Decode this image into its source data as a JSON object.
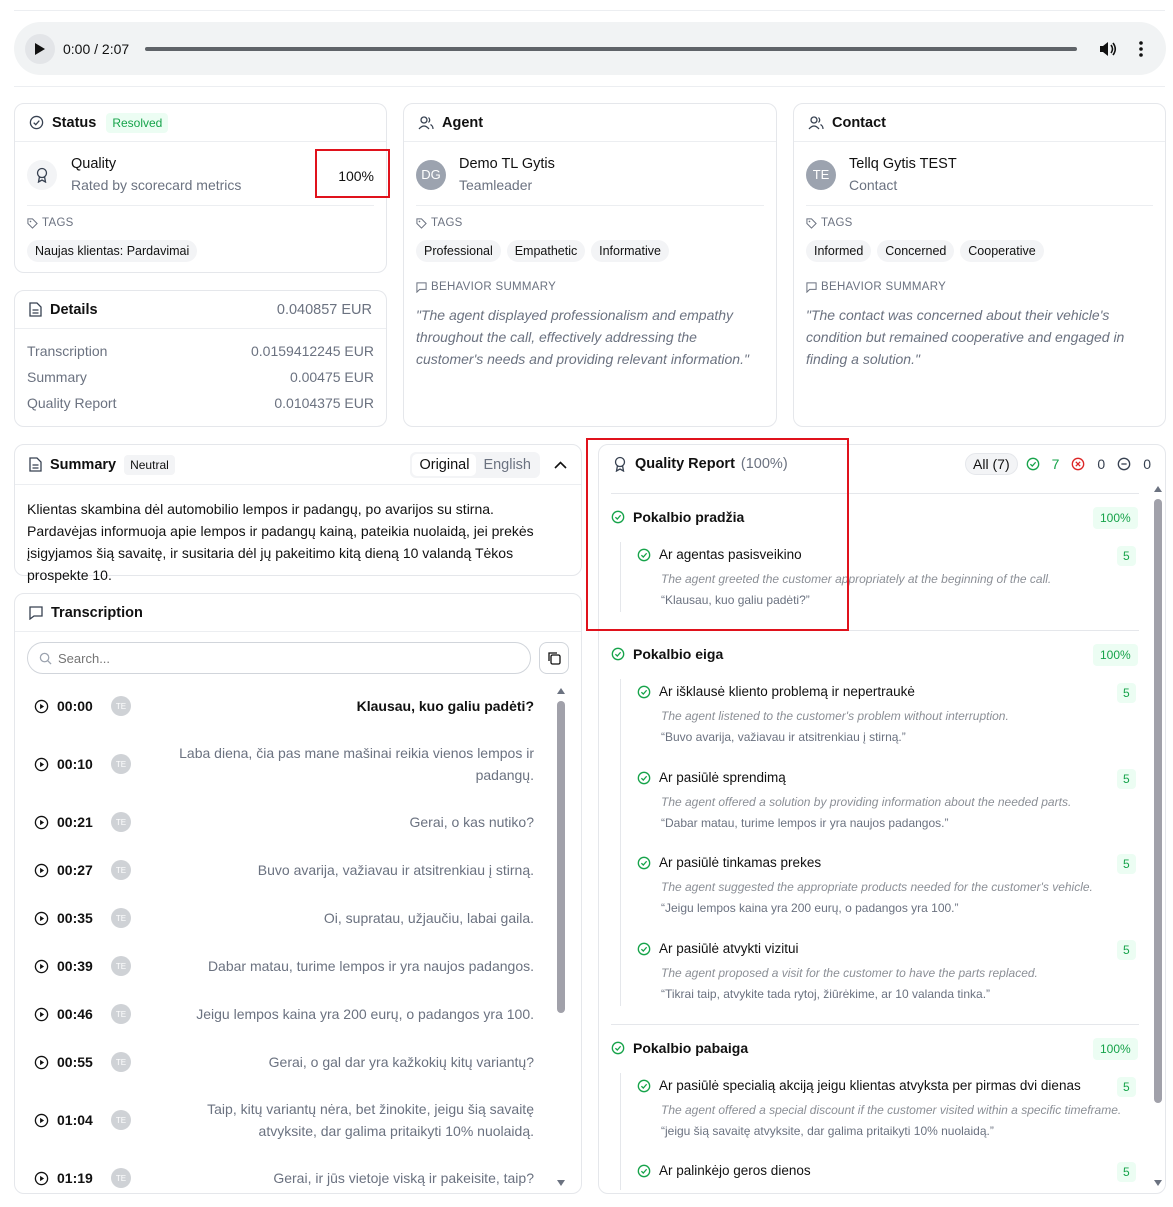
{
  "player": {
    "time": "0:00 / 2:07"
  },
  "status": {
    "title": "Status",
    "badge": "Resolved",
    "quality_label": "Quality",
    "quality_sub": "Rated by scorecard metrics",
    "quality_value": "100%",
    "tags_label": "TAGS",
    "tags": [
      "Naujas klientas: Pardavimai"
    ]
  },
  "details": {
    "title": "Details",
    "total": "0.040857 EUR",
    "rows": [
      {
        "label": "Transcription",
        "value": "0.0159412245 EUR"
      },
      {
        "label": "Summary",
        "value": "0.00475 EUR"
      },
      {
        "label": "Quality Report",
        "value": "0.0104375 EUR"
      }
    ]
  },
  "agent": {
    "title": "Agent",
    "initials": "DG",
    "name": "Demo TL Gytis",
    "role": "Teamleader",
    "tags_label": "TAGS",
    "tags": [
      "Professional",
      "Empathetic",
      "Informative"
    ],
    "behavior_label": "BEHAVIOR SUMMARY",
    "behavior": "\"The agent displayed professionalism and empathy throughout the call, effectively addressing the customer's needs and providing relevant information.\""
  },
  "contact": {
    "title": "Contact",
    "initials": "TE",
    "name": "Tellq Gytis TEST",
    "role": "Contact",
    "tags_label": "TAGS",
    "tags": [
      "Informed",
      "Concerned",
      "Cooperative"
    ],
    "behavior_label": "BEHAVIOR SUMMARY",
    "behavior": "\"The contact was concerned about their vehicle's condition but remained cooperative and engaged in finding a solution.\""
  },
  "summary": {
    "title": "Summary",
    "badge": "Neutral",
    "tab_original": "Original",
    "tab_english": "English",
    "text": "Klientas skambina dėl automobilio lempos ir padangų, po avarijos su stirna. Pardavėjas informuoja apie lempos ir padangų kainą, pateikia nuolaidą, jei prekės įsigyjamos šią savaitę, ir susitaria dėl jų pakeitimo kitą dieną 10 valandą Tėkos prospekte 10."
  },
  "transcription": {
    "title": "Transcription",
    "search_placeholder": "Search...",
    "speaker": "TE",
    "rows": [
      {
        "time": "00:00",
        "text": "Klausau, kuo galiu padėti?",
        "bold": true
      },
      {
        "time": "00:10",
        "text": "Laba diena, čia pas mane mašinai reikia vienos lempos ir padangų."
      },
      {
        "time": "00:21",
        "text": "Gerai, o kas nutiko?"
      },
      {
        "time": "00:27",
        "text": "Buvo avarija, važiavau ir atsitrenkiau į stirną."
      },
      {
        "time": "00:35",
        "text": "Oi, supratau, užjaučiu, labai gaila."
      },
      {
        "time": "00:39",
        "text": "Dabar matau, turime lempos ir yra naujos padangos."
      },
      {
        "time": "00:46",
        "text": "Jeigu lempos kaina yra 200 eurų, o padangos yra 100."
      },
      {
        "time": "00:55",
        "text": "Gerai, o gal dar yra kažkokių kitų variantų?"
      },
      {
        "time": "01:04",
        "text": "Taip, kitų variantų nėra, bet žinokite, jeigu šią savaitę atvyksite, dar galima pritaikyti 10% nuolaidą."
      },
      {
        "time": "01:19",
        "text": "Gerai, ir jūs vietoje viską ir pakeisite, taip?"
      }
    ]
  },
  "quality": {
    "title": "Quality Report",
    "pct": "(100%)",
    "filter_all": "All (7)",
    "pass_count": "7",
    "fail_count": "0",
    "na_count": "0",
    "sections": [
      {
        "name": "Pokalbio pradžia",
        "pct": "100%",
        "items": [
          {
            "name": "Ar agentas pasisveikino",
            "score": "5",
            "desc": "The agent greeted the customer appropriately at the beginning of the call.",
            "quote": "“Klausau, kuo galiu padėti?”"
          }
        ]
      },
      {
        "name": "Pokalbio eiga",
        "pct": "100%",
        "items": [
          {
            "name": "Ar išklausė kliento problemą ir nepertraukė",
            "score": "5",
            "desc": "The agent listened to the customer's problem without interruption.",
            "quote": "“Buvo avarija, važiavau ir atsitrenkiau į stirną.”"
          },
          {
            "name": "Ar pasiūlė sprendimą",
            "score": "5",
            "desc": "The agent offered a solution by providing information about the needed parts.",
            "quote": "“Dabar matau, turime lempos ir yra naujos padangos.”"
          },
          {
            "name": "Ar pasiūlė tinkamas prekes",
            "score": "5",
            "desc": "The agent suggested the appropriate products needed for the customer's vehicle.",
            "quote": "“Jeigu lempos kaina yra 200 eurų, o padangos yra 100.”"
          },
          {
            "name": "Ar pasiūlė atvykti vizitui",
            "score": "5",
            "desc": "The agent proposed a visit for the customer to have the parts replaced.",
            "quote": "“Tikrai taip, atvykite tada rytoj, žiūrėkime, ar 10 valanda tinka.”"
          }
        ]
      },
      {
        "name": "Pokalbio pabaiga",
        "pct": "100%",
        "items": [
          {
            "name": "Ar pasiūlė specialią akciją jeigu klientas atvyksta per pirmas dvi dienas",
            "score": "5",
            "desc": "The agent offered a special discount if the customer visited within a specific timeframe.",
            "quote": "“jeigu šią savaitę atvyksite, dar galima pritaikyti 10% nuolaidą.”"
          },
          {
            "name": "Ar palinkėjo geros dienos",
            "score": "5",
            "desc": "",
            "quote": ""
          }
        ]
      }
    ]
  }
}
